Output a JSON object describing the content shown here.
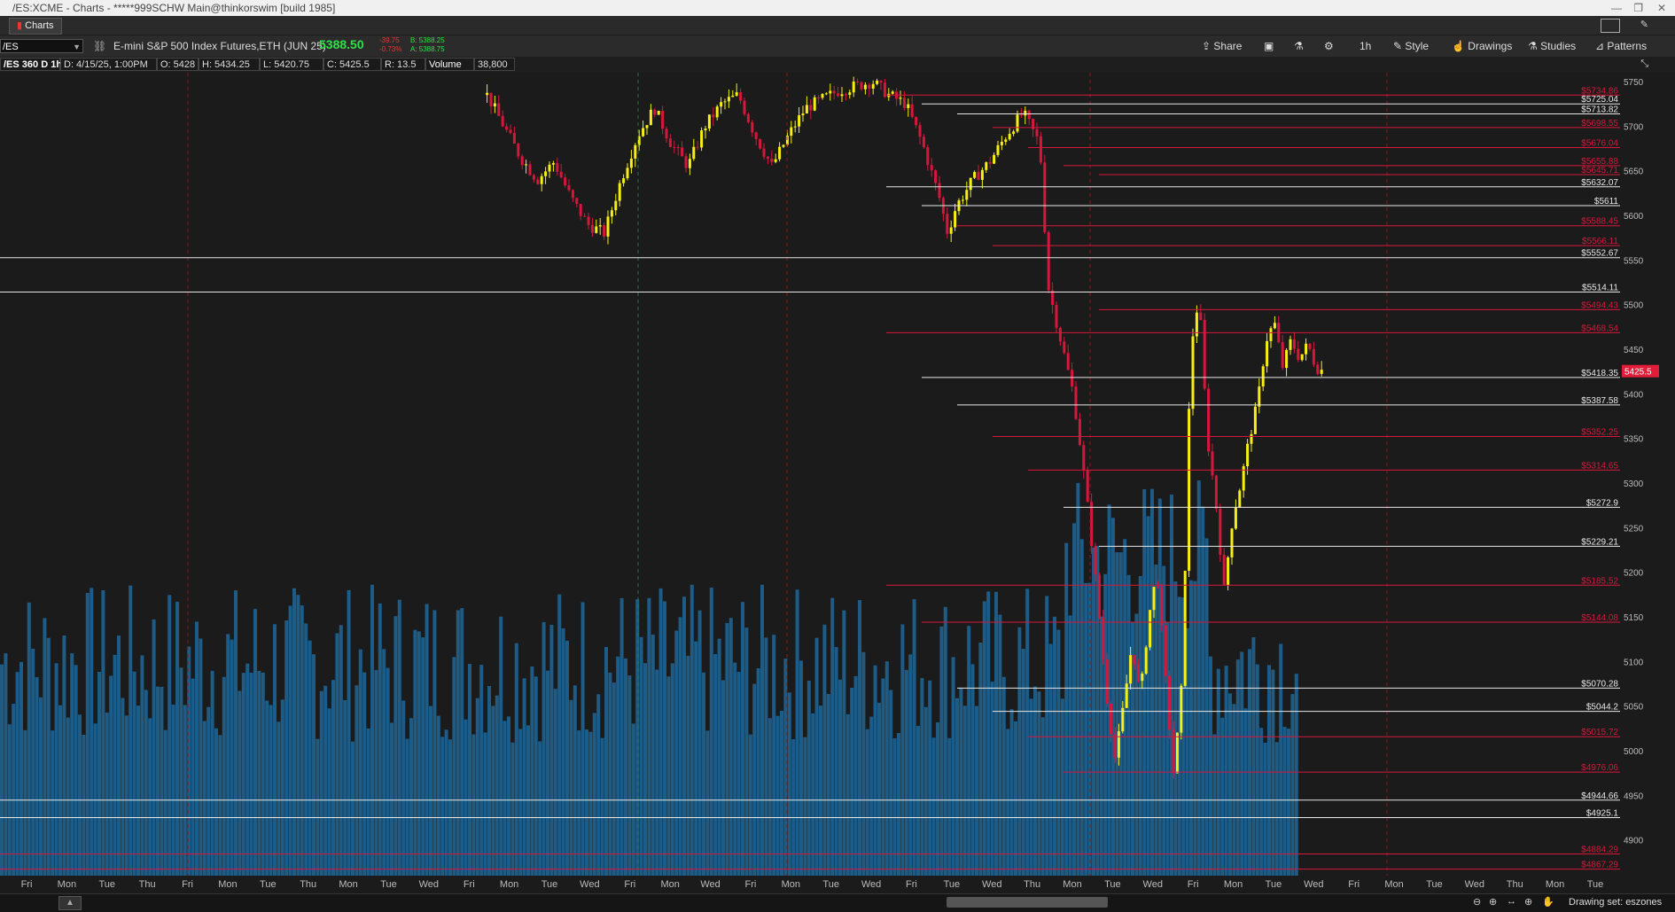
{
  "window": {
    "title": "/ES:XCME - Charts - *****999SCHW Main@thinkorswim [build 1985]"
  },
  "tab": {
    "label": "Charts"
  },
  "toolbar": {
    "symbol": "/ES",
    "description": "E-mini S&P 500 Index Futures,ETH (JUN 25)",
    "last_price": "5388.50",
    "change": "-39.75",
    "change_pct": "-0.73%",
    "bid": "B: 5388.25",
    "ask": "A: 5388.75",
    "share_label": "Share",
    "timeframe": "1h",
    "style_label": "Style",
    "drawings_label": "Drawings",
    "studies_label": "Studies",
    "patterns_label": "Patterns"
  },
  "info": {
    "aggregation": "/ES 360 D 1h",
    "date": "D: 4/15/25, 1:00PM",
    "open": "O: 5428",
    "high": "H: 5434.25",
    "low": "L: 5420.75",
    "close": "C: 5425.5",
    "range": "R: 13.5",
    "volume_label": "Volume",
    "volume_value": "38,800"
  },
  "status": {
    "drawing_set": "Drawing set: eszones"
  },
  "colors": {
    "up": "#f7ef14",
    "down": "#d6173c",
    "volume": "#1c5c86",
    "white_level": "#e8e8e8",
    "red_level": "#d6173c",
    "price_tag": "#e11d3a"
  },
  "chart_data": {
    "type": "candlestick",
    "y_axis_ticks": [
      5750,
      5700,
      5650,
      5600,
      5550,
      5500,
      5450,
      5400,
      5350,
      5300,
      5250,
      5200,
      5150,
      5100,
      5050,
      5000,
      4950,
      4900
    ],
    "ylim": [
      4860,
      5760
    ],
    "x_axis_labels": [
      "Fri",
      "Mon",
      "Tue",
      "Thu",
      "Fri",
      "Mon",
      "Tue",
      "Thu",
      "Mon",
      "Tue",
      "Wed",
      "Fri",
      "Mon",
      "Tue",
      "Wed",
      "Fri",
      "Mon",
      "Wed",
      "Fri",
      "Mon",
      "Tue",
      "Wed",
      "Fri",
      "Tue",
      "Wed",
      "Thu",
      "Mon",
      "Tue",
      "Wed",
      "Fri",
      "Mon",
      "Tue",
      "Wed",
      "Fri",
      "Mon",
      "Tue",
      "Wed",
      "Thu",
      "Mon",
      "Tue"
    ],
    "current_price_tag": "5425.5",
    "levels": [
      {
        "label": "$5734.86",
        "value": 5734.86,
        "color": "red"
      },
      {
        "label": "$5725.04",
        "value": 5725.04,
        "color": "white"
      },
      {
        "label": "$5713.82",
        "value": 5713.82,
        "color": "white"
      },
      {
        "label": "$5698.55",
        "value": 5698.55,
        "color": "red"
      },
      {
        "label": "$5676.04",
        "value": 5676.04,
        "color": "red"
      },
      {
        "label": "$5655.88",
        "value": 5655.88,
        "color": "red"
      },
      {
        "label": "$5645.71",
        "value": 5645.71,
        "color": "red"
      },
      {
        "label": "$5632.07",
        "value": 5632.07,
        "color": "white"
      },
      {
        "label": "$5611",
        "value": 5611,
        "color": "white"
      },
      {
        "label": "$5588.45",
        "value": 5588.45,
        "color": "red"
      },
      {
        "label": "$5566.11",
        "value": 5566.11,
        "color": "red"
      },
      {
        "label": "$5552.67",
        "value": 5552.67,
        "color": "white"
      },
      {
        "label": "$5514.11",
        "value": 5514.11,
        "color": "white"
      },
      {
        "label": "$5494.43",
        "value": 5494.43,
        "color": "red"
      },
      {
        "label": "$5468.54",
        "value": 5468.54,
        "color": "red"
      },
      {
        "label": "$5418.35",
        "value": 5418.35,
        "color": "white"
      },
      {
        "label": "$5387.58",
        "value": 5387.58,
        "color": "white"
      },
      {
        "label": "$5352.25",
        "value": 5352.25,
        "color": "red"
      },
      {
        "label": "$5314.65",
        "value": 5314.65,
        "color": "red"
      },
      {
        "label": "$5272.9",
        "value": 5272.9,
        "color": "white"
      },
      {
        "label": "$5229.21",
        "value": 5229.21,
        "color": "white"
      },
      {
        "label": "$5185.52",
        "value": 5185.52,
        "color": "red"
      },
      {
        "label": "$5144.08",
        "value": 5144.08,
        "color": "red"
      },
      {
        "label": "$5070.28",
        "value": 5070.28,
        "color": "white"
      },
      {
        "label": "$5044.2",
        "value": 5044.2,
        "color": "white"
      },
      {
        "label": "$5015.72",
        "value": 5015.72,
        "color": "red"
      },
      {
        "label": "$4976.06",
        "value": 4976.06,
        "color": "red"
      },
      {
        "label": "$4944.66",
        "value": 4944.66,
        "color": "white"
      },
      {
        "label": "$4925.1",
        "value": 4925.1,
        "color": "white"
      },
      {
        "label": "$4884.29",
        "value": 4884.29,
        "color": "red"
      },
      {
        "label": "$4867.29",
        "value": 4867.29,
        "color": "red"
      }
    ],
    "price_path": [
      [
        0.29,
        5735
      ],
      [
        0.3,
        5700
      ],
      [
        0.31,
        5665
      ],
      [
        0.32,
        5640
      ],
      [
        0.33,
        5660
      ],
      [
        0.34,
        5620
      ],
      [
        0.35,
        5590
      ],
      [
        0.36,
        5580
      ],
      [
        0.37,
        5640
      ],
      [
        0.38,
        5690
      ],
      [
        0.39,
        5720
      ],
      [
        0.4,
        5680
      ],
      [
        0.41,
        5655
      ],
      [
        0.42,
        5700
      ],
      [
        0.43,
        5725
      ],
      [
        0.44,
        5735
      ],
      [
        0.45,
        5690
      ],
      [
        0.46,
        5655
      ],
      [
        0.47,
        5690
      ],
      [
        0.48,
        5720
      ],
      [
        0.49,
        5730
      ],
      [
        0.5,
        5740
      ],
      [
        0.51,
        5745
      ],
      [
        0.52,
        5750
      ],
      [
        0.53,
        5735
      ],
      [
        0.54,
        5725
      ],
      [
        0.55,
        5680
      ],
      [
        0.56,
        5620
      ],
      [
        0.565,
        5580
      ],
      [
        0.57,
        5610
      ],
      [
        0.58,
        5640
      ],
      [
        0.59,
        5660
      ],
      [
        0.6,
        5690
      ],
      [
        0.61,
        5715
      ],
      [
        0.62,
        5680
      ],
      [
        0.625,
        5520
      ],
      [
        0.63,
        5480
      ],
      [
        0.635,
        5440
      ],
      [
        0.64,
        5400
      ],
      [
        0.645,
        5330
      ],
      [
        0.65,
        5250
      ],
      [
        0.655,
        5160
      ],
      [
        0.66,
        5060
      ],
      [
        0.665,
        4990
      ],
      [
        0.67,
        5050
      ],
      [
        0.675,
        5120
      ],
      [
        0.68,
        5060
      ],
      [
        0.685,
        5150
      ],
      [
        0.69,
        5200
      ],
      [
        0.695,
        5080
      ],
      [
        0.7,
        4970
      ],
      [
        0.705,
        5080
      ],
      [
        0.71,
        5450
      ],
      [
        0.715,
        5510
      ],
      [
        0.72,
        5350
      ],
      [
        0.725,
        5280
      ],
      [
        0.73,
        5180
      ],
      [
        0.735,
        5260
      ],
      [
        0.74,
        5300
      ],
      [
        0.745,
        5350
      ],
      [
        0.75,
        5390
      ],
      [
        0.755,
        5460
      ],
      [
        0.76,
        5480
      ],
      [
        0.765,
        5430
      ],
      [
        0.77,
        5460
      ],
      [
        0.775,
        5440
      ],
      [
        0.78,
        5455
      ],
      [
        0.785,
        5430
      ],
      [
        0.79,
        5425
      ]
    ],
    "volume_path": [],
    "grid": false
  }
}
